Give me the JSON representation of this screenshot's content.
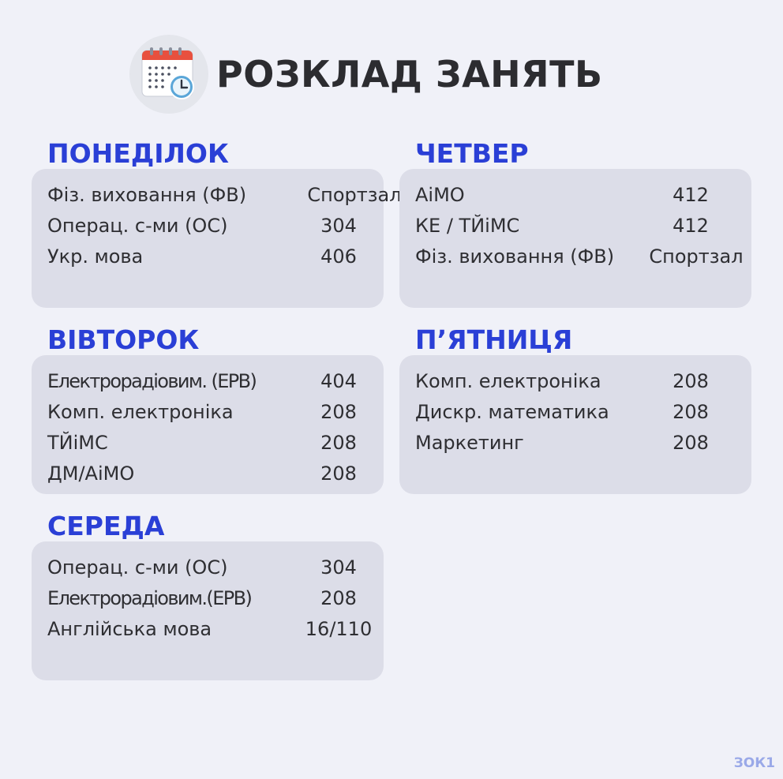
{
  "header": {
    "title": "РОЗКЛАД ЗАНЯТЬ",
    "icon": "calendar-clock-icon"
  },
  "days": {
    "monday": {
      "title": "ПОНЕДІЛОК",
      "rows": [
        {
          "subject": "Фіз. виховання (ФВ)",
          "room": "Спортзал"
        },
        {
          "subject": "Операц. с-ми (ОС)",
          "room": "304"
        },
        {
          "subject": "Укр. мова",
          "room": "406"
        }
      ]
    },
    "tuesday": {
      "title": "ВІВТОРОК",
      "rows": [
        {
          "subject": "Електрорадіовим. (ЕРВ)",
          "room": "404"
        },
        {
          "subject": "Комп. електроніка",
          "room": "208"
        },
        {
          "subject": "ТЙіМС",
          "room": "208"
        },
        {
          "subject": "ДМ/АіМО",
          "room": "208"
        }
      ]
    },
    "wednesday": {
      "title": "СЕРЕДА",
      "rows": [
        {
          "subject": "Операц. с-ми (ОС)",
          "room": "304"
        },
        {
          "subject": "Електрорадіовим.(ЕРВ)",
          "room": "208"
        },
        {
          "subject": "Англійська мова",
          "room": "16/110"
        }
      ]
    },
    "thursday": {
      "title": "ЧЕТВЕР",
      "rows": [
        {
          "subject": "АіМО",
          "room": "412"
        },
        {
          "subject": "КЕ / ТЙіМС",
          "room": "412"
        },
        {
          "subject": "Фіз. виховання (ФВ)",
          "room": "Спортзал"
        }
      ]
    },
    "friday": {
      "title": "П’ЯТНИЦЯ",
      "rows": [
        {
          "subject": "Комп. електроніка",
          "room": "208"
        },
        {
          "subject": "Дискр. математика",
          "room": "208"
        },
        {
          "subject": "Маркетинг",
          "room": "208"
        }
      ]
    }
  },
  "watermark": "ЗОК1",
  "colors": {
    "background": "#f0f1f8",
    "card": "#dcdde8",
    "day_title": "#2a3fd6",
    "text": "#2e2e32",
    "watermark": "#9aa9e8"
  }
}
